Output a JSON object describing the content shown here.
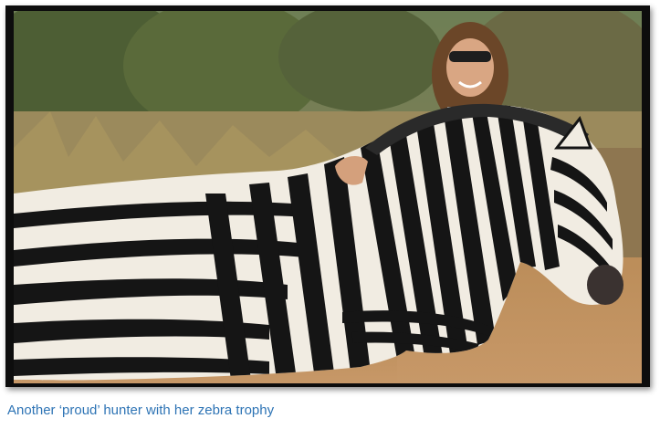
{
  "photo": {
    "subject_icon": "zebra-trophy-photo-icon"
  },
  "caption": {
    "text": "Another ‘proud’ hunter with her zebra trophy",
    "color": "#2e74b5"
  }
}
